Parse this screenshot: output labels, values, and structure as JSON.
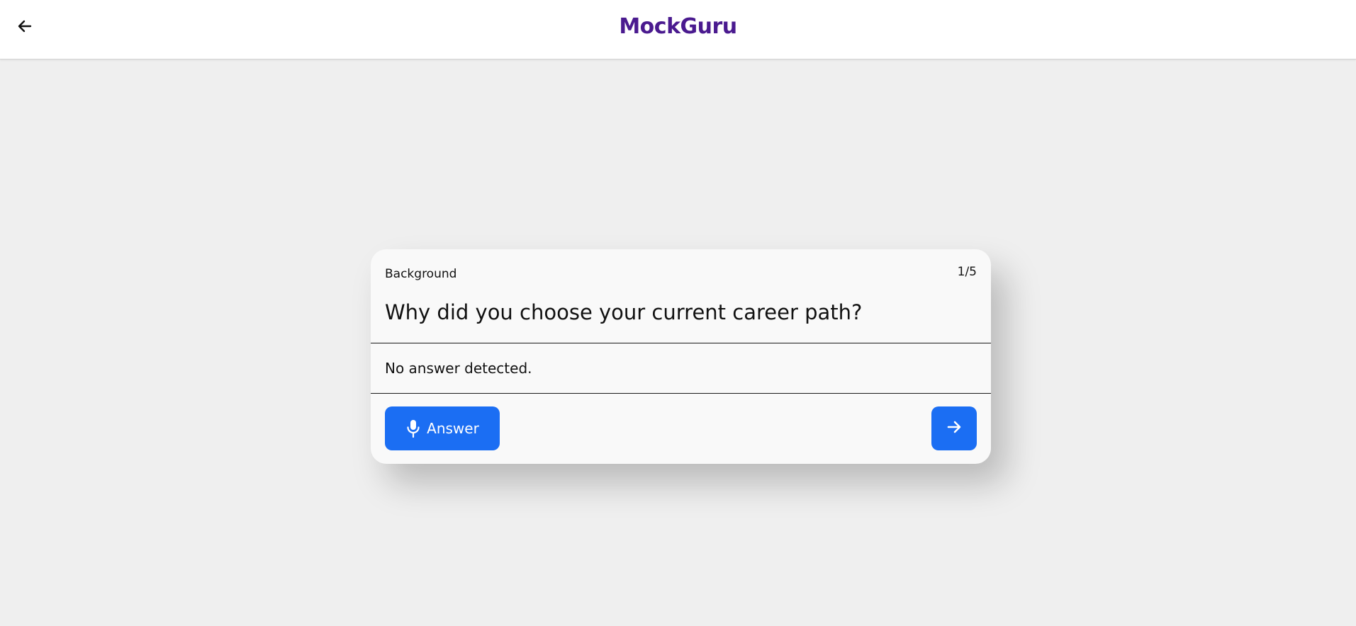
{
  "header": {
    "brand": "MockGuru",
    "back_icon": "arrow-left-icon",
    "brand_color": "#4a1a8f"
  },
  "card": {
    "category": "Background",
    "counter": "1/5",
    "question": "Why did you choose your current career path?",
    "answer_text": "No answer detected.",
    "answer_button": {
      "label": "Answer",
      "icon": "microphone-icon"
    },
    "next_button": {
      "icon": "arrow-right-icon"
    },
    "accent_color": "#1b6ef3"
  }
}
